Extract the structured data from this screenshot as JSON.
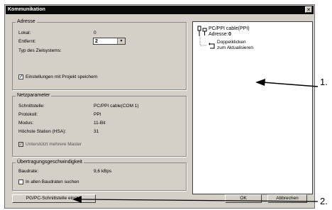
{
  "window": {
    "title": "Kommunikation"
  },
  "adresse": {
    "legend": "Adresse",
    "lokal_label": "Lokal:",
    "lokal_value": "0",
    "entfernt_label": "Entfernt:",
    "entfernt_value": "2",
    "typ_label": "Typ des Zielsystems:",
    "save_label": "Einstellungen mit Projekt speichern",
    "save_checked": "✓"
  },
  "netz": {
    "legend": "Netzparameter",
    "rows": [
      {
        "label": "Schnittstelle:",
        "value": "PC/PPI cable(COM 1)"
      },
      {
        "label": "Protokoll:",
        "value": "PPI"
      },
      {
        "label": "Modus:",
        "value": "11-Bit"
      },
      {
        "label": "Höchste Station (HSA):",
        "value": "31"
      }
    ],
    "multi_master_label": "Unterstützt mehrere Master",
    "multi_master_checked": "✓"
  },
  "uebertragung": {
    "legend": "Übertragungsgeschwindigkeit",
    "baud_label": "Baudrate:",
    "baud_value": "9,6 kBps",
    "search_label": "In allen Baudraten suchen"
  },
  "tree": {
    "cable": "PC/PPI cable(PPI)",
    "address_label": "Adresse:",
    "address_value": "0",
    "refresh_line1": "Doppelklicken",
    "refresh_line2": "zum Aktualisieren"
  },
  "buttons": {
    "interface": "PG/PC-Schnittstelle einst...",
    "ok": "OK",
    "cancel": "Abbrechen"
  },
  "callouts": {
    "one": "1.",
    "two": "2."
  }
}
